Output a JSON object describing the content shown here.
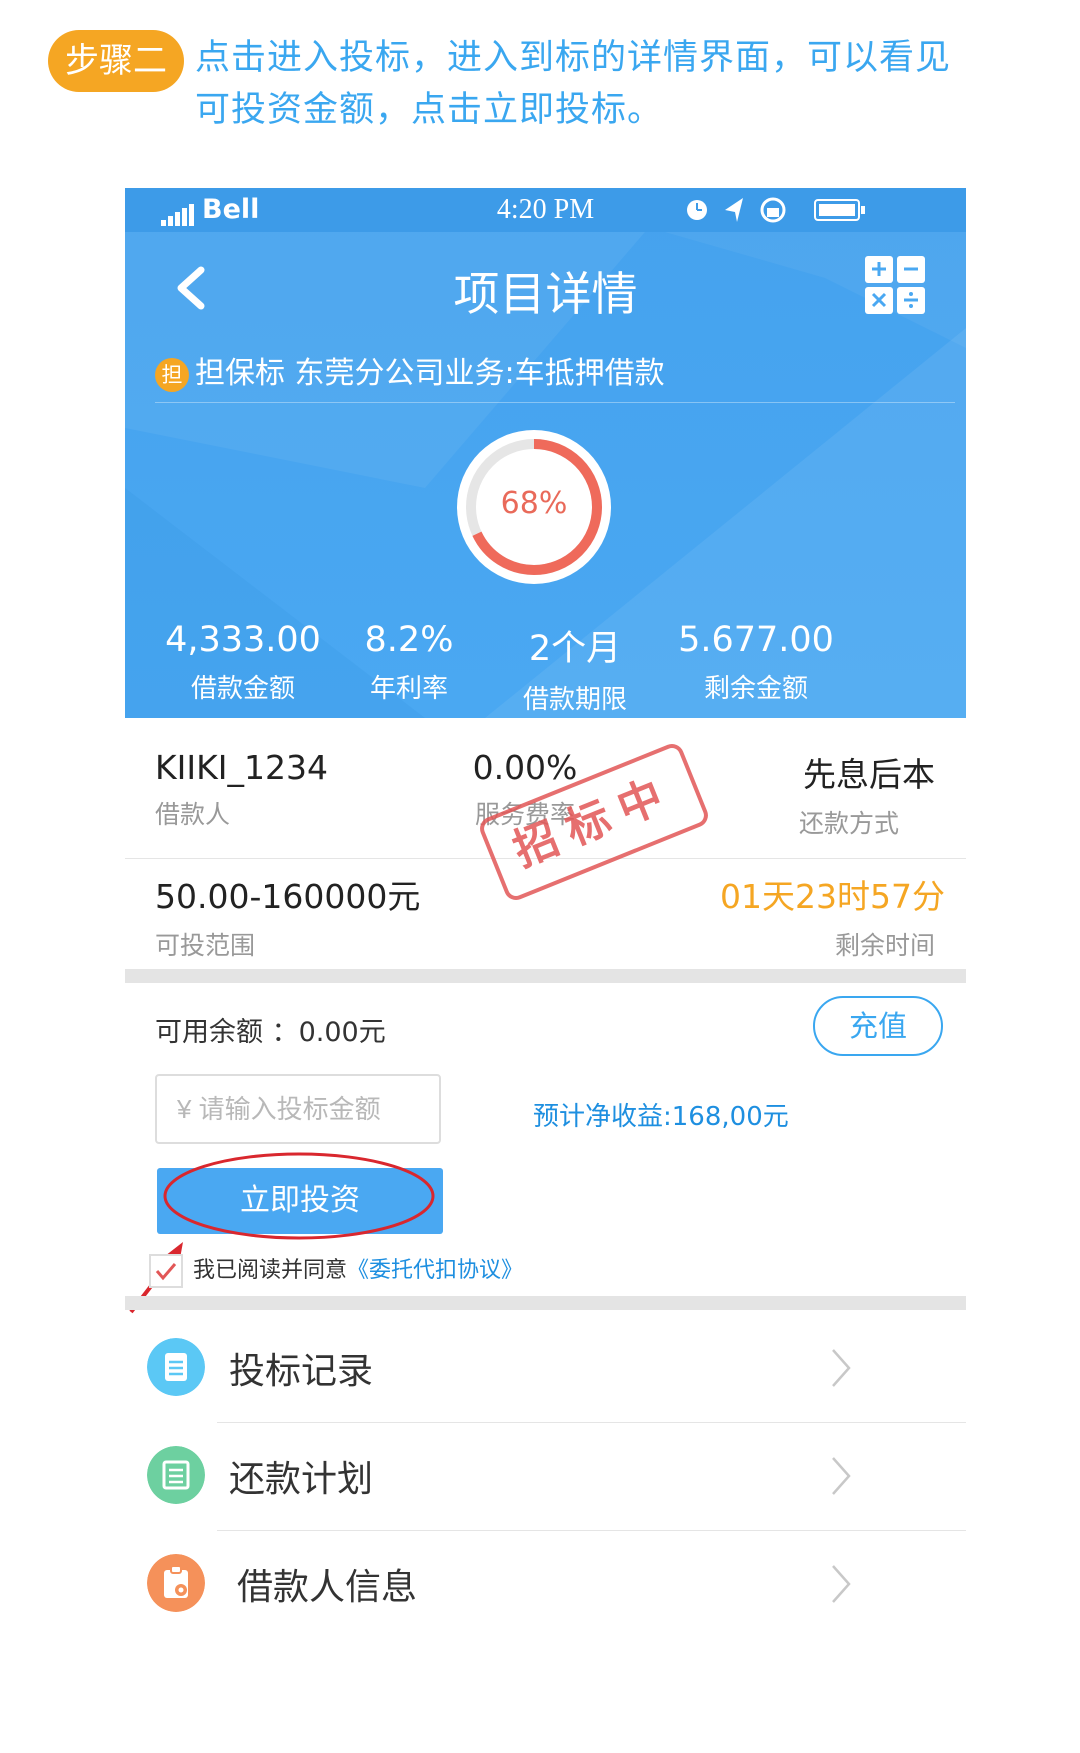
{
  "step": {
    "badge": "步骤二",
    "instruction_line1": "点击进入投标，进入到标的详情界面，可以看见",
    "instruction_line2": "可投资金额，点击立即投标。"
  },
  "status_bar": {
    "carrier": "Bell",
    "time": "4:20 PM"
  },
  "nav": {
    "title": "项目详情",
    "back_icon": "chevron-left-icon",
    "calculator_icon": "calculator-icon"
  },
  "project": {
    "badge": "担",
    "subject": "担保标 东莞分公司业务:车抵押借款",
    "progress_label": "68%",
    "progress": 0.68
  },
  "stats": [
    {
      "value": "4,333.00",
      "label": "借款金额"
    },
    {
      "value": "8.2%",
      "label": "年利率"
    },
    {
      "value": "2个月",
      "label": "借款期限"
    },
    {
      "value": "5.677.00",
      "label": "剩余金额"
    }
  ],
  "info": {
    "borrower": {
      "value": "KIIKI_1234",
      "label": "借款人"
    },
    "service_rate": {
      "value": "0.00%",
      "label": "服务费率"
    },
    "repay_method": {
      "value": "先息后本",
      "label": "还款方式"
    },
    "invest_range": {
      "value": "50.00-160000元",
      "label": "可投范围"
    },
    "time_left": {
      "value": "01天23时57分",
      "label": "剩余时间"
    },
    "stamp": "招标中"
  },
  "invest": {
    "balance_label": "可用余额 ：0.00元",
    "recharge_label": "充值",
    "amount_placeholder": "¥ 请输入投标金额",
    "estimate": "预计净收益:168,00元",
    "invest_button": "立即投资",
    "agree_text": "我已阅读并同意",
    "agree_link": "《委托代扣协议》"
  },
  "menu": [
    {
      "label": "投标记录",
      "icon": "document-icon",
      "color": "#5bc8f5"
    },
    {
      "label": "还款计划",
      "icon": "list-icon",
      "color": "#6dd0a0"
    },
    {
      "label": "借款人信息",
      "icon": "clipboard-icon",
      "color": "#f5915a"
    }
  ],
  "colors": {
    "accent": "#3aa7f0",
    "warning": "#f5a623",
    "danger": "#e25757"
  }
}
